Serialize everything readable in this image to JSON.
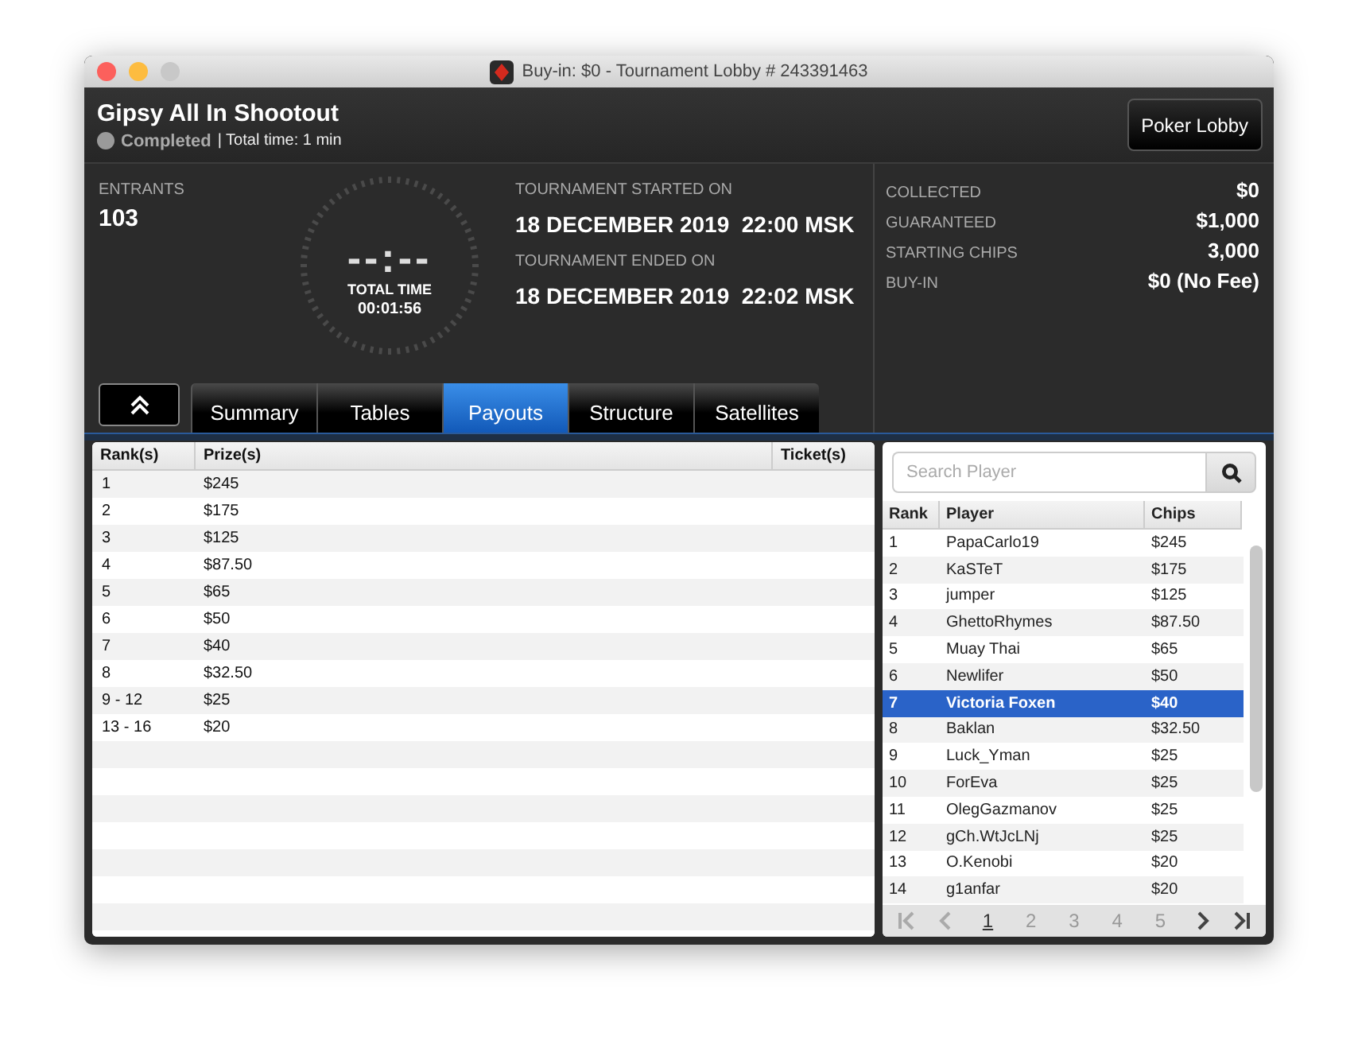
{
  "window": {
    "title": "Buy-in: $0 - Tournament Lobby # 243391463"
  },
  "header": {
    "name": "Gipsy All In Shootout",
    "status": "Completed",
    "total_time": "| Total time: 1 min",
    "lobby_button": "Poker Lobby"
  },
  "info": {
    "entrants_label": "ENTRANTS",
    "entrants": "103",
    "clock": "--:--",
    "clock_label": "TOTAL TIME",
    "clock_value": "00:01:56",
    "started_label": "TOURNAMENT STARTED ON",
    "started": "18 DECEMBER 2019  22:00 MSK",
    "ended_label": "TOURNAMENT ENDED ON",
    "ended": "18 DECEMBER 2019  22:02 MSK"
  },
  "stats": [
    {
      "label": "COLLECTED",
      "value": "$0"
    },
    {
      "label": "GUARANTEED",
      "value": "$1,000"
    },
    {
      "label": "STARTING CHIPS",
      "value": "3,000"
    },
    {
      "label": "BUY-IN",
      "value": "$0 (No Fee)"
    }
  ],
  "tabs": [
    {
      "label": "Summary",
      "selected": false
    },
    {
      "label": "Tables",
      "selected": false
    },
    {
      "label": "Payouts",
      "selected": true
    },
    {
      "label": "Structure",
      "selected": false
    },
    {
      "label": "Satellites",
      "selected": false
    }
  ],
  "payouts": {
    "columns": [
      "Rank(s)",
      "Prize(s)",
      "Ticket(s)"
    ],
    "rows": [
      [
        "1",
        "$245"
      ],
      [
        "2",
        "$175"
      ],
      [
        "3",
        "$125"
      ],
      [
        "4",
        "$87.50"
      ],
      [
        "5",
        "$65"
      ],
      [
        "6",
        "$50"
      ],
      [
        "7",
        "$40"
      ],
      [
        "8",
        "$32.50"
      ],
      [
        "9 - 12",
        "$25"
      ],
      [
        "13 - 16",
        "$20"
      ]
    ]
  },
  "players": {
    "search": {
      "placeholder": "Search Player"
    },
    "columns": [
      "Rank",
      "Player",
      "Chips"
    ],
    "rows": [
      {
        "rank": "1",
        "player": "PapaCarlo19",
        "chips": "$245",
        "selected": false
      },
      {
        "rank": "2",
        "player": "KaSTeT",
        "chips": "$175",
        "selected": false
      },
      {
        "rank": "3",
        "player": "jumper",
        "chips": "$125",
        "selected": false
      },
      {
        "rank": "4",
        "player": "GhettoRhymes",
        "chips": "$87.50",
        "selected": false
      },
      {
        "rank": "5",
        "player": "Muay Thai",
        "chips": "$65",
        "selected": false
      },
      {
        "rank": "6",
        "player": "Newlifer",
        "chips": "$50",
        "selected": false
      },
      {
        "rank": "7",
        "player": "Victoria Foxen",
        "chips": "$40",
        "selected": true
      },
      {
        "rank": "8",
        "player": "Baklan",
        "chips": "$32.50",
        "selected": false
      },
      {
        "rank": "9",
        "player": "Luck_Yman",
        "chips": "$25",
        "selected": false
      },
      {
        "rank": "10",
        "player": "ForEva",
        "chips": "$25",
        "selected": false
      },
      {
        "rank": "11",
        "player": "OlegGazmanov",
        "chips": "$25",
        "selected": false
      },
      {
        "rank": "12",
        "player": "gCh.WtJcLNj",
        "chips": "$25",
        "selected": false
      },
      {
        "rank": "13",
        "player": "O.Kenobi",
        "chips": "$20",
        "selected": false
      },
      {
        "rank": "14",
        "player": "g1anfar",
        "chips": "$20",
        "selected": false
      }
    ],
    "pages": [
      {
        "label": "1",
        "selected": true
      },
      {
        "label": "2",
        "selected": false
      },
      {
        "label": "3",
        "selected": false
      },
      {
        "label": "4",
        "selected": false
      },
      {
        "label": "5",
        "selected": false
      }
    ]
  }
}
